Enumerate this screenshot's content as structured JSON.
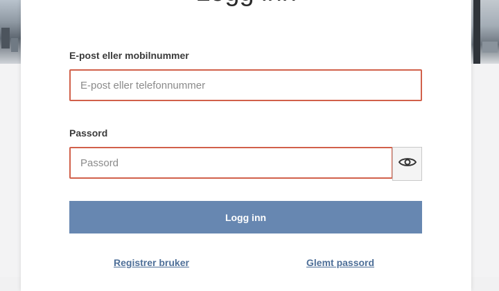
{
  "login": {
    "title": "Logg inn",
    "email_label": "E-post eller mobilnummer",
    "email_placeholder": "E-post eller telefonnummer",
    "email_value": "",
    "password_label": "Passord",
    "password_placeholder": "Passord",
    "password_value": "",
    "show_password_icon": "eye-icon",
    "submit_label": "Logg inn",
    "register_link": "Registrer bruker",
    "forgot_link": "Glemt passord"
  },
  "colors": {
    "error_border": "#d1604a",
    "button": "#6787b1",
    "link": "#4e6f98"
  }
}
